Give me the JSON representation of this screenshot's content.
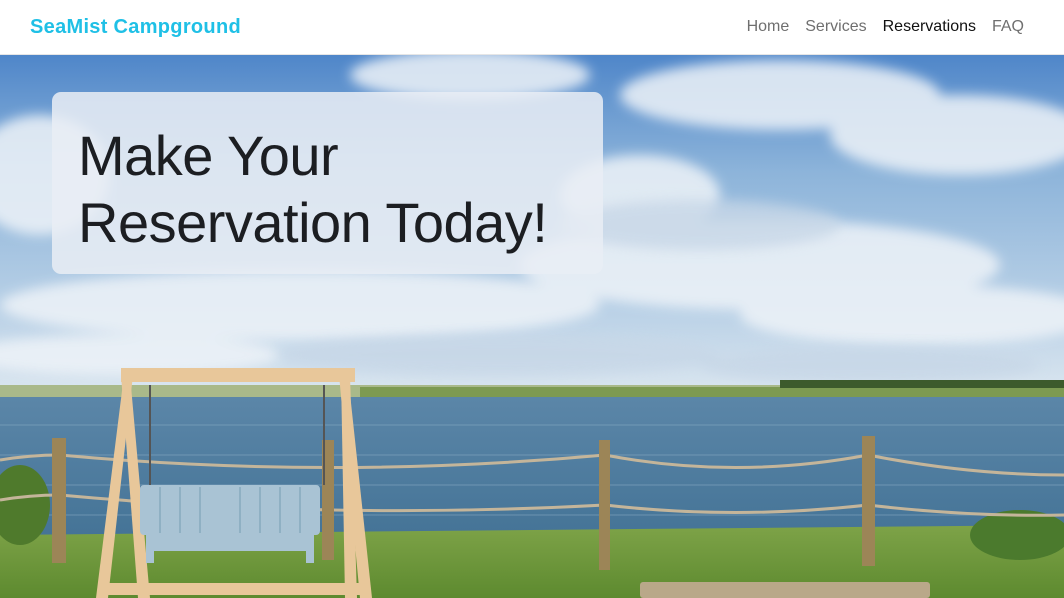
{
  "navbar": {
    "brand": "SeaMist Campground",
    "links": [
      {
        "label": "Home",
        "active": false
      },
      {
        "label": "Services",
        "active": false
      },
      {
        "label": "Reservations",
        "active": true
      },
      {
        "label": "FAQ",
        "active": false
      }
    ]
  },
  "hero": {
    "headline_line1": "Make Your",
    "headline_line2": "Reservation Today!",
    "scene": "seaside landscape photo with porch swing, rope fence, water and cloudy sky"
  },
  "colors": {
    "brand": "#1fc0e6",
    "nav_text": "#6f6f6f",
    "nav_active": "#111111",
    "headline": "#1c1e22"
  }
}
